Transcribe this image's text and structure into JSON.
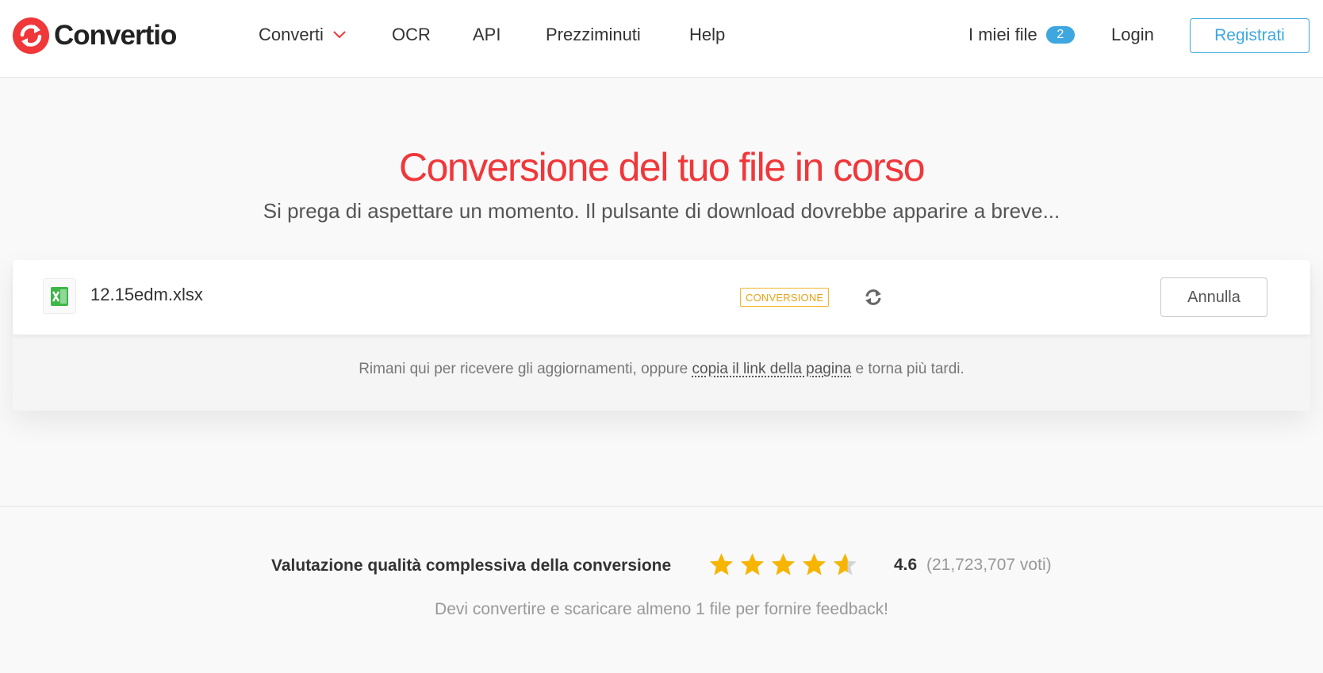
{
  "header": {
    "brand": "Convertio",
    "nav": {
      "converti": "Converti",
      "ocr": "OCR",
      "api": "API",
      "prezzi": "Prezzi",
      "minuti": "minuti",
      "help": "Help",
      "files": "I miei file",
      "files_count": "2",
      "login": "Login",
      "register": "Registrati"
    },
    "colors": {
      "brand_red": "#f0373a",
      "accent_blue": "#3ea7e0"
    }
  },
  "hero": {
    "title": "Conversione del tuo file in corso",
    "subtitle": "Si prega di aspettare un momento. Il pulsante di download dovrebbe apparire a breve..."
  },
  "file": {
    "icon": "excel-file-icon",
    "name": "12.15edm.xlsx",
    "status": "CONVERSIONE",
    "status_color": "#f2b530",
    "cancel": "Annulla"
  },
  "note": {
    "before": "Rimani qui per ricevere gli aggiornamenti, oppure ",
    "link": "copia il link della pagina",
    "after": " e torna più tardi."
  },
  "rating": {
    "label": "Valutazione qualità complessiva della conversione",
    "stars_filled": 4.6,
    "stars_max": 5,
    "score": "4.6",
    "votes": "(21,723,707 voti)",
    "feedback": "Devi convertire e scaricare almeno 1 file per fornire feedback!"
  }
}
